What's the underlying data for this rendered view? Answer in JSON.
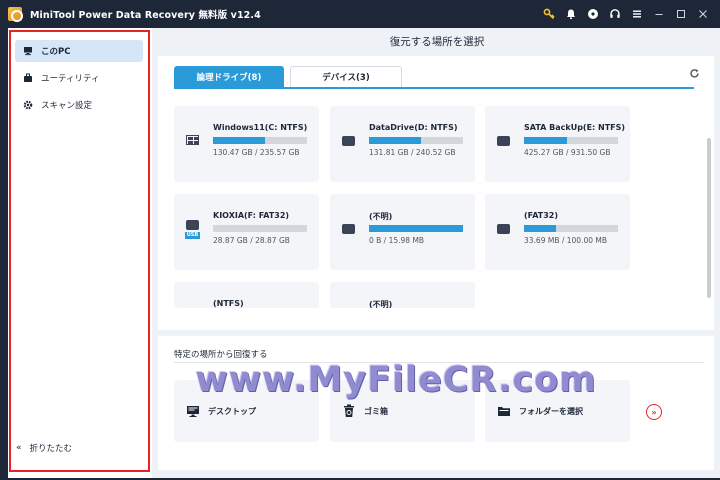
{
  "titlebar": {
    "title": "MiniTool Power Data Recovery 無料版 v12.4",
    "icons": [
      "key-icon",
      "bell-icon",
      "disc-icon",
      "headset-icon",
      "menu-icon",
      "minimize-icon",
      "maximize-icon",
      "close-icon"
    ]
  },
  "sidebar": {
    "items": [
      {
        "label": "このPC",
        "icon": "computer-icon",
        "active": true
      },
      {
        "label": "ユーティリティ",
        "icon": "toolbox-icon",
        "active": false
      },
      {
        "label": "スキャン設定",
        "icon": "gear-icon",
        "active": false
      }
    ],
    "collapse_label": "折りたたむ"
  },
  "main": {
    "title": "復元する場所を選択",
    "tabs": [
      {
        "label": "論理ドライブ(8)",
        "active": true
      },
      {
        "label": "デバイス(3)",
        "active": false
      }
    ],
    "drives": [
      {
        "name": "Windows11(C: NTFS)",
        "size": "130.47 GB / 235.57 GB",
        "icon": "windows-drive-icon",
        "used_fraction": 0.554
      },
      {
        "name": "DataDrive(D: NTFS)",
        "size": "131.81 GB / 240.52 GB",
        "icon": "hard-drive-icon",
        "used_fraction": 0.548
      },
      {
        "name": "SATA BackUp(E: NTFS)",
        "size": "425.27 GB / 931.50 GB",
        "icon": "hard-drive-icon",
        "used_fraction": 0.457
      },
      {
        "name": "KIOXIA(F: FAT32)",
        "size": "28.87 GB / 28.87 GB",
        "icon": "usb-drive-icon",
        "used_fraction": 0.0
      },
      {
        "name": "(不明)",
        "size": "0 B / 15.98 MB",
        "icon": "hard-drive-icon",
        "used_fraction": 1.0
      },
      {
        "name": "(FAT32)",
        "size": "33.69 MB / 100.00 MB",
        "icon": "hard-drive-icon",
        "used_fraction": 0.337
      },
      {
        "name": "(NTFS)",
        "size": "",
        "icon": "",
        "used_fraction": 0
      },
      {
        "name": "(不明)",
        "size": "",
        "icon": "",
        "used_fraction": 0
      }
    ],
    "usb_label": "USB"
  },
  "specific": {
    "title": "特定の場所から回復する",
    "locations": [
      {
        "label": "デスクトップ",
        "icon": "desktop-icon"
      },
      {
        "label": "ゴミ箱",
        "icon": "recycle-bin-icon"
      },
      {
        "label": "フォルダーを選択",
        "icon": "folder-icon"
      }
    ]
  },
  "watermark": "www.MyFileCR.com",
  "colors": {
    "accent": "#2a9bd8",
    "titlebar": "#1d2738",
    "highlight": "#e52521"
  }
}
